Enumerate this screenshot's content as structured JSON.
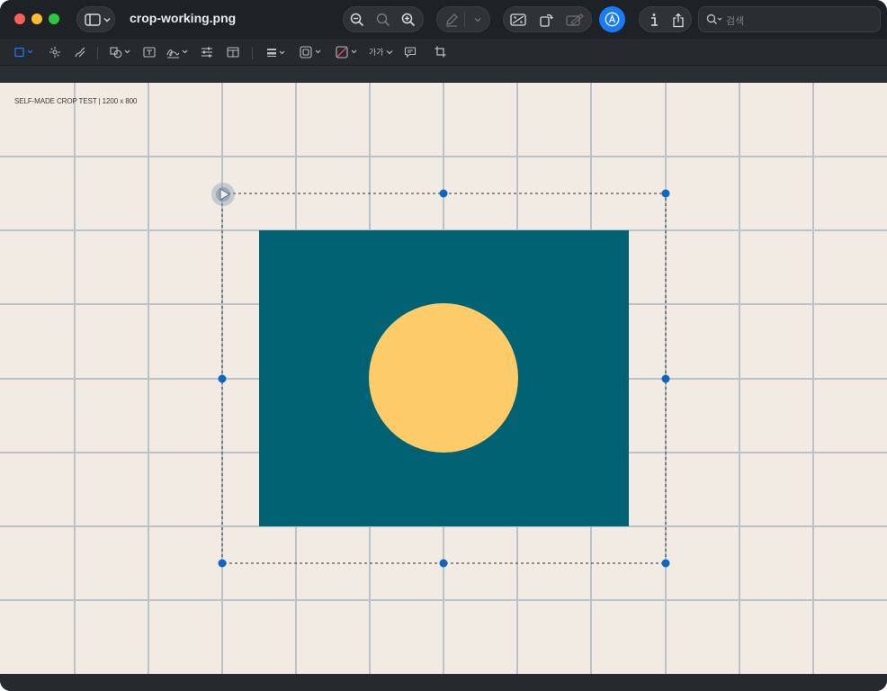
{
  "window": {
    "title": "crop-working.png",
    "search_placeholder": "검색",
    "traffic_colors": {
      "close": "#ff5f57",
      "minimize": "#febc2e",
      "zoom": "#28c840"
    }
  },
  "toolbar": {
    "icons": [
      "sidebar-icon",
      "chevron-down-icon",
      "zoom-out-icon",
      "actual-size-icon",
      "zoom-in-icon",
      "highlight-icon",
      "rotate-icon",
      "markup-icon",
      "info-icon",
      "share-icon",
      "search-icon"
    ],
    "markup_toggle_active_color": "#1a7cf5"
  },
  "markup_bar": {
    "text_style_label": "가가",
    "icons": [
      "rect-selection-icon",
      "smart-lasso-icon",
      "sketch-icon",
      "shapes-icon",
      "text-box-icon",
      "signature-icon",
      "adjust-color-icon",
      "page-layout-icon",
      "line-style-icon",
      "border-color-icon",
      "fill-color-icon",
      "note-icon",
      "crop-icon"
    ]
  },
  "canvas": {
    "label": "SELF-MADE CROP TEST | 1200 x 800",
    "background": "#f2ebe3",
    "grid_color": "#b9c3c8",
    "rect_color": "#016274",
    "circle_color": "#fecb69",
    "selection_handle_color": "#0e66c4"
  }
}
